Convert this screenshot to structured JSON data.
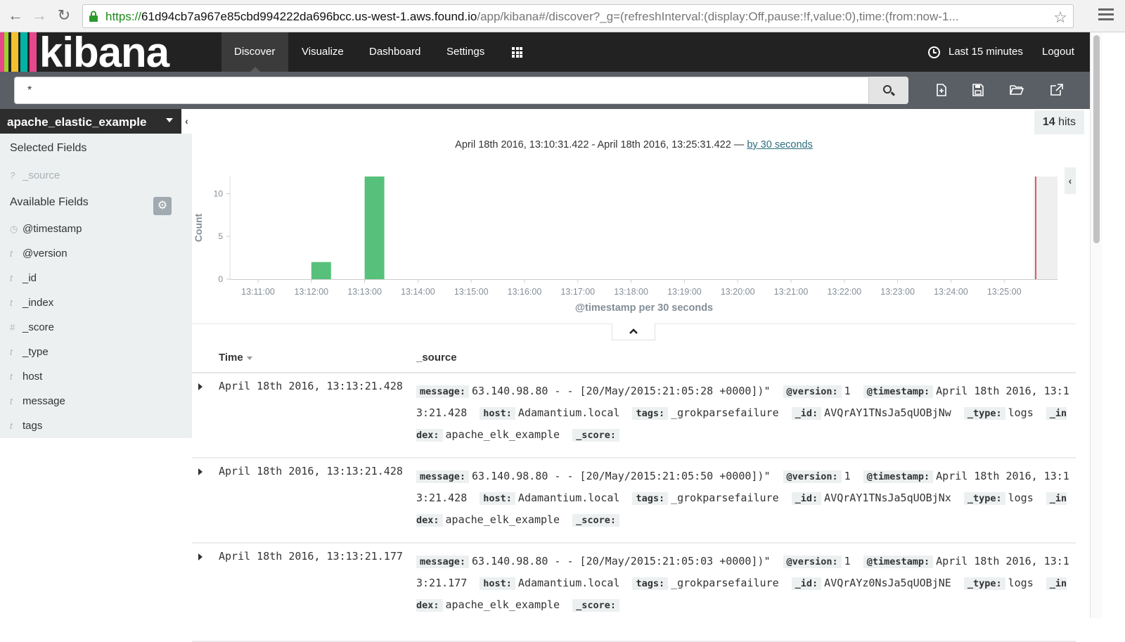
{
  "browser": {
    "url_proto": "https://",
    "url_host": "61d94cb7a967e85cbd994222da696bcc.us-west-1.aws.found.io",
    "url_path": "/app/kibana#/discover?_g=(refreshInterval:(display:Off,pause:!f,value:0),time:(from:now-1..."
  },
  "nav": {
    "logo": "kibana",
    "items": [
      "Discover",
      "Visualize",
      "Dashboard",
      "Settings"
    ],
    "time_label": "Last 15 minutes",
    "logout": "Logout"
  },
  "search": {
    "query": "*"
  },
  "sidebar": {
    "index_name": "apache_elastic_example",
    "selected_heading": "Selected Fields",
    "selected_fields": [
      {
        "type": "?",
        "name": "_source"
      }
    ],
    "available_heading": "Available Fields",
    "available_fields": [
      {
        "type": "clock",
        "name": "@timestamp"
      },
      {
        "type": "t",
        "name": "@version"
      },
      {
        "type": "t",
        "name": "_id"
      },
      {
        "type": "t",
        "name": "_index"
      },
      {
        "type": "#",
        "name": "_score"
      },
      {
        "type": "t",
        "name": "_type"
      },
      {
        "type": "t",
        "name": "host"
      },
      {
        "type": "t",
        "name": "message"
      },
      {
        "type": "t",
        "name": "tags"
      }
    ]
  },
  "hits": {
    "count": "14",
    "label": "hits"
  },
  "date_range": {
    "text": "April 18th 2016, 13:10:31.422 - April 18th 2016, 13:25:31.422 —",
    "interval_link": "by 30 seconds"
  },
  "chart_data": {
    "type": "bar",
    "x": [
      "13:11:00",
      "13:12:00",
      "13:13:00",
      "13:14:00",
      "13:15:00",
      "13:16:00",
      "13:17:00",
      "13:18:00",
      "13:19:00",
      "13:20:00",
      "13:21:00",
      "13:22:00",
      "13:23:00",
      "13:24:00",
      "13:25:00"
    ],
    "bars": [
      {
        "x": "13:12:00",
        "value": 2
      },
      {
        "x": "13:13:00",
        "value": 12
      }
    ],
    "ylabel": "Count",
    "xlabel": "@timestamp per 30 seconds",
    "yticks": [
      0,
      5,
      10
    ],
    "ylim": [
      0,
      12
    ],
    "bar_color": "#57c17b",
    "now_marker_color": "#e05b5b"
  },
  "table": {
    "col_time": "Time",
    "col_source": "_source",
    "rows": [
      {
        "time": "April 18th 2016, 13:13:21.428",
        "fields": [
          {
            "k": "message:",
            "v": "63.140.98.80 - - [20/May/2015:21:05:28 +0000])\""
          },
          {
            "k": "@version:",
            "v": "1"
          },
          {
            "k": "@timestamp:",
            "v": "April 18th 2016, 13:13:21.428"
          },
          {
            "k": "host:",
            "v": "Adamantium.local"
          },
          {
            "k": "tags:",
            "v": "_grokparsefailure"
          },
          {
            "k": "_id:",
            "v": "AVQrAY1TNsJa5qUOBjNw"
          },
          {
            "k": "_type:",
            "v": "logs"
          },
          {
            "k": "_index:",
            "v": "apache_elk_example"
          },
          {
            "k": "_score:",
            "v": ""
          }
        ]
      },
      {
        "time": "April 18th 2016, 13:13:21.428",
        "fields": [
          {
            "k": "message:",
            "v": "63.140.98.80 - - [20/May/2015:21:05:50 +0000])\""
          },
          {
            "k": "@version:",
            "v": "1"
          },
          {
            "k": "@timestamp:",
            "v": "April 18th 2016, 13:13:21.428"
          },
          {
            "k": "host:",
            "v": "Adamantium.local"
          },
          {
            "k": "tags:",
            "v": "_grokparsefailure"
          },
          {
            "k": "_id:",
            "v": "AVQrAY1TNsJa5qUOBjNx"
          },
          {
            "k": "_type:",
            "v": "logs"
          },
          {
            "k": "_index:",
            "v": "apache_elk_example"
          },
          {
            "k": "_score:",
            "v": ""
          }
        ]
      },
      {
        "time": "April 18th 2016, 13:13:21.177",
        "fields": [
          {
            "k": "message:",
            "v": "63.140.98.80 - - [20/May/2015:21:05:03 +0000])\""
          },
          {
            "k": "@version:",
            "v": "1"
          },
          {
            "k": "@timestamp:",
            "v": "April 18th 2016, 13:13:21.177"
          },
          {
            "k": "host:",
            "v": "Adamantium.local"
          },
          {
            "k": "tags:",
            "v": "_grokparsefailure"
          },
          {
            "k": "_id:",
            "v": "AVQrAYz0NsJa5qUOBjNE"
          },
          {
            "k": "_type:",
            "v": "logs"
          },
          {
            "k": "_index:",
            "v": "apache_elk_example"
          },
          {
            "k": "_score:",
            "v": ""
          }
        ]
      }
    ]
  }
}
